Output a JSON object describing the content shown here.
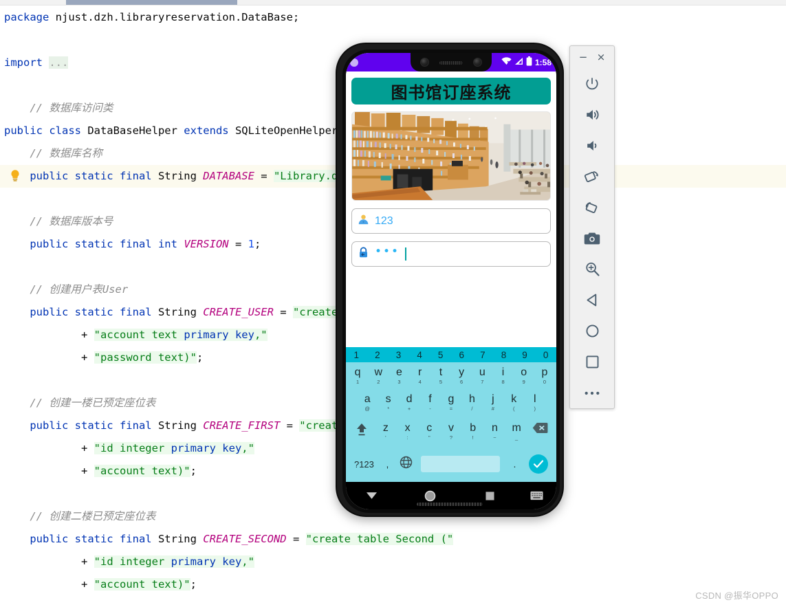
{
  "ide": {
    "scrollbar": {
      "name": "horizontal-scrollbar"
    },
    "code_lines": [
      {
        "id": "l1",
        "indent": 0,
        "highlight": false,
        "bulb": false,
        "tokens": [
          {
            "t": "kw",
            "v": "package"
          },
          {
            "t": "plain",
            "v": " njust.dzh.libraryreservation.DataBase;"
          }
        ]
      },
      {
        "id": "l2",
        "indent": 0,
        "highlight": false,
        "bulb": false,
        "tokens": []
      },
      {
        "id": "l3",
        "indent": 0,
        "highlight": false,
        "bulb": false,
        "tokens": [
          {
            "t": "kw",
            "v": "import"
          },
          {
            "t": "plain",
            "v": " "
          },
          {
            "t": "fold",
            "v": "..."
          }
        ]
      },
      {
        "id": "l4",
        "indent": 0,
        "highlight": false,
        "bulb": false,
        "tokens": []
      },
      {
        "id": "l5",
        "indent": 1,
        "highlight": false,
        "bulb": false,
        "tokens": [
          {
            "t": "cmt",
            "v": "// 数据库访问类"
          }
        ]
      },
      {
        "id": "l6",
        "indent": 0,
        "highlight": false,
        "bulb": false,
        "tokens": [
          {
            "t": "kw",
            "v": "public class"
          },
          {
            "t": "plain",
            "v": " DataBaseHelper "
          },
          {
            "t": "kw",
            "v": "extends"
          },
          {
            "t": "plain",
            "v": " SQLiteOpenHelper {"
          }
        ]
      },
      {
        "id": "l7",
        "indent": 1,
        "highlight": false,
        "bulb": false,
        "tokens": [
          {
            "t": "cmt",
            "v": "// 数据库名称"
          }
        ]
      },
      {
        "id": "l8",
        "indent": 1,
        "highlight": true,
        "bulb": true,
        "tokens": [
          {
            "t": "kw",
            "v": "public static final"
          },
          {
            "t": "plain",
            "v": " String "
          },
          {
            "t": "cst",
            "v": "DATABASE"
          },
          {
            "t": "plain",
            "v": " = "
          },
          {
            "t": "str",
            "v": "\"Library.db\""
          },
          {
            "t": "plain",
            "v": ";"
          }
        ]
      },
      {
        "id": "l9",
        "indent": 0,
        "highlight": false,
        "bulb": false,
        "tokens": []
      },
      {
        "id": "l10",
        "indent": 1,
        "highlight": false,
        "bulb": false,
        "tokens": [
          {
            "t": "cmt",
            "v": "// 数据库版本号"
          }
        ]
      },
      {
        "id": "l11",
        "indent": 1,
        "highlight": false,
        "bulb": false,
        "tokens": [
          {
            "t": "kw",
            "v": "public static final int"
          },
          {
            "t": "plain",
            "v": " "
          },
          {
            "t": "cst",
            "v": "VERSION"
          },
          {
            "t": "plain",
            "v": " = "
          },
          {
            "t": "num",
            "v": "1"
          },
          {
            "t": "plain",
            "v": ";"
          }
        ]
      },
      {
        "id": "l12",
        "indent": 0,
        "highlight": false,
        "bulb": false,
        "tokens": []
      },
      {
        "id": "l13",
        "indent": 1,
        "highlight": false,
        "bulb": false,
        "tokens": [
          {
            "t": "cmt",
            "v": "// 创建用户表User"
          }
        ]
      },
      {
        "id": "l14",
        "indent": 1,
        "highlight": false,
        "bulb": false,
        "tokens": [
          {
            "t": "kw",
            "v": "public static final"
          },
          {
            "t": "plain",
            "v": " String "
          },
          {
            "t": "cst",
            "v": "CREATE_USER"
          },
          {
            "t": "plain",
            "v": " = "
          },
          {
            "t": "str",
            "v": "\"create table User (\""
          }
        ]
      },
      {
        "id": "l15",
        "indent": 3,
        "highlight": false,
        "bulb": false,
        "tokens": [
          {
            "t": "plain",
            "v": "+ "
          },
          {
            "t": "str",
            "v": "\"account text "
          },
          {
            "t": "strp",
            "v": "primary key"
          },
          {
            "t": "str",
            "v": ",\""
          }
        ]
      },
      {
        "id": "l16",
        "indent": 3,
        "highlight": false,
        "bulb": false,
        "tokens": [
          {
            "t": "plain",
            "v": "+ "
          },
          {
            "t": "str",
            "v": "\"password text)\""
          },
          {
            "t": "plain",
            "v": ";"
          }
        ]
      },
      {
        "id": "l17",
        "indent": 0,
        "highlight": false,
        "bulb": false,
        "tokens": []
      },
      {
        "id": "l18",
        "indent": 1,
        "highlight": false,
        "bulb": false,
        "tokens": [
          {
            "t": "cmt",
            "v": "// 创建一楼已预定座位表"
          }
        ]
      },
      {
        "id": "l19",
        "indent": 1,
        "highlight": false,
        "bulb": false,
        "tokens": [
          {
            "t": "kw",
            "v": "public static final"
          },
          {
            "t": "plain",
            "v": " String "
          },
          {
            "t": "cst",
            "v": "CREATE_FIRST"
          },
          {
            "t": "plain",
            "v": " = "
          },
          {
            "t": "str",
            "v": "\"create table First (\""
          }
        ]
      },
      {
        "id": "l20",
        "indent": 3,
        "highlight": false,
        "bulb": false,
        "tokens": [
          {
            "t": "plain",
            "v": "+ "
          },
          {
            "t": "str",
            "v": "\"id integer "
          },
          {
            "t": "strp",
            "v": "primary key"
          },
          {
            "t": "str",
            "v": ",\""
          }
        ]
      },
      {
        "id": "l21",
        "indent": 3,
        "highlight": false,
        "bulb": false,
        "tokens": [
          {
            "t": "plain",
            "v": "+ "
          },
          {
            "t": "str",
            "v": "\"account text)\""
          },
          {
            "t": "plain",
            "v": ";"
          }
        ]
      },
      {
        "id": "l22",
        "indent": 0,
        "highlight": false,
        "bulb": false,
        "tokens": []
      },
      {
        "id": "l23",
        "indent": 1,
        "highlight": false,
        "bulb": false,
        "tokens": [
          {
            "t": "cmt",
            "v": "// 创建二楼已预定座位表"
          }
        ]
      },
      {
        "id": "l24",
        "indent": 1,
        "highlight": false,
        "bulb": false,
        "tokens": [
          {
            "t": "kw",
            "v": "public static final"
          },
          {
            "t": "plain",
            "v": " String "
          },
          {
            "t": "cst",
            "v": "CREATE_SECOND"
          },
          {
            "t": "plain",
            "v": " = "
          },
          {
            "t": "str",
            "v": "\"create table Second (\""
          }
        ]
      },
      {
        "id": "l25",
        "indent": 3,
        "highlight": false,
        "bulb": false,
        "tokens": [
          {
            "t": "plain",
            "v": "+ "
          },
          {
            "t": "str",
            "v": "\"id integer "
          },
          {
            "t": "strp",
            "v": "primary key"
          },
          {
            "t": "str",
            "v": ",\""
          }
        ]
      },
      {
        "id": "l26",
        "indent": 3,
        "highlight": false,
        "bulb": false,
        "tokens": [
          {
            "t": "plain",
            "v": "+ "
          },
          {
            "t": "str",
            "v": "\"account text)\""
          },
          {
            "t": "plain",
            "v": ";"
          }
        ]
      }
    ]
  },
  "emulator": {
    "statusbar": {
      "clock": "1:58",
      "icons": [
        "wifi-off-icon",
        "signal-icon",
        "battery-icon"
      ]
    },
    "app": {
      "title": "图书馆订座系统",
      "photo_alt": "library-interior-photo",
      "username_field": {
        "value": "123",
        "icon": "person-icon"
      },
      "password_field": {
        "value": "•••",
        "icon": "lock-icon"
      }
    },
    "keyboard": {
      "suggestions": [
        "1",
        "2",
        "3",
        "4",
        "5",
        "6",
        "7",
        "8",
        "9",
        "0"
      ],
      "row1": [
        {
          "main": "q",
          "sub": "1"
        },
        {
          "main": "w",
          "sub": "2"
        },
        {
          "main": "e",
          "sub": "3"
        },
        {
          "main": "r",
          "sub": "4"
        },
        {
          "main": "t",
          "sub": "5"
        },
        {
          "main": "y",
          "sub": "6"
        },
        {
          "main": "u",
          "sub": "7"
        },
        {
          "main": "i",
          "sub": "8"
        },
        {
          "main": "o",
          "sub": "9"
        },
        {
          "main": "p",
          "sub": "0"
        }
      ],
      "row2": [
        {
          "main": "a",
          "sub": "@"
        },
        {
          "main": "s",
          "sub": "*"
        },
        {
          "main": "d",
          "sub": "+"
        },
        {
          "main": "f",
          "sub": "-"
        },
        {
          "main": "g",
          "sub": "="
        },
        {
          "main": "h",
          "sub": "/"
        },
        {
          "main": "j",
          "sub": "#"
        },
        {
          "main": "k",
          "sub": "("
        },
        {
          "main": "l",
          "sub": ")"
        }
      ],
      "row3": [
        {
          "main": "z",
          "sub": "'"
        },
        {
          "main": "x",
          "sub": ":"
        },
        {
          "main": "c",
          "sub": "\""
        },
        {
          "main": "v",
          "sub": "?"
        },
        {
          "main": "b",
          "sub": "!"
        },
        {
          "main": "n",
          "sub": "~"
        },
        {
          "main": "m",
          "sub": "_"
        }
      ],
      "shift_icon": "shift-icon",
      "delete_icon": "backspace-icon",
      "symbols_key": "?123",
      "comma_key": ",",
      "globe_key": "globe-icon",
      "space_key": "",
      "period_key": ".",
      "enter_icon": "check-icon"
    },
    "navbar": [
      {
        "name": "nav-back-button",
        "icon": "triangle-down-icon"
      },
      {
        "name": "nav-home-button",
        "icon": "circle-icon"
      },
      {
        "name": "nav-recents-button",
        "icon": "square-icon"
      },
      {
        "name": "nav-keyboard-button",
        "icon": "keyboard-icon"
      }
    ]
  },
  "toolbar": {
    "minimize_label": "−",
    "close_label": "×",
    "buttons": [
      {
        "name": "power-button",
        "icon": "power-icon"
      },
      {
        "name": "volume-up-button",
        "icon": "volume-up-icon"
      },
      {
        "name": "volume-down-button",
        "icon": "volume-down-icon"
      },
      {
        "name": "rotate-left-button",
        "icon": "rotate-left-icon"
      },
      {
        "name": "rotate-right-button",
        "icon": "rotate-right-icon"
      },
      {
        "name": "screenshot-button",
        "icon": "camera-icon"
      },
      {
        "name": "zoom-button",
        "icon": "magnifier-icon"
      },
      {
        "name": "back-button",
        "icon": "triangle-left-icon"
      },
      {
        "name": "home-button",
        "icon": "circle-outline-icon"
      },
      {
        "name": "overview-button",
        "icon": "square-outline-icon"
      },
      {
        "name": "more-button",
        "icon": "ellipsis-icon"
      }
    ]
  },
  "watermark": "CSDN @振华OPPO"
}
